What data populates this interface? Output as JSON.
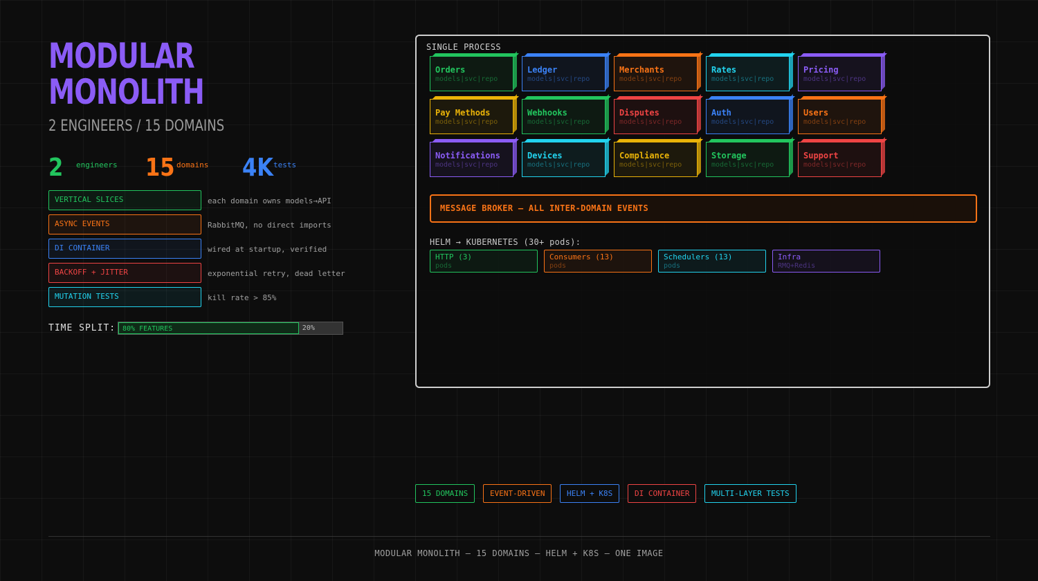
{
  "title": {
    "line1": "MODULAR",
    "line2": "MONOLITH"
  },
  "subtitle": "2 ENGINEERS / 15 DOMAINS",
  "colors": {
    "purple": "#8b5cf6",
    "green": "#22c55e",
    "orange": "#f97316",
    "blue": "#3b82f6",
    "red": "#ef4444",
    "cyan": "#22d3ee",
    "yellow": "#eab308"
  },
  "stats": [
    {
      "value": "2",
      "label": "engineers",
      "color": "#22c55e"
    },
    {
      "value": "15",
      "label": "domains",
      "color": "#f97316"
    },
    {
      "value": "4K",
      "label": "tests",
      "color": "#3b82f6"
    }
  ],
  "features": [
    {
      "label": "VERTICAL SLICES",
      "desc": "each domain owns models→API",
      "color": "#22c55e"
    },
    {
      "label": "ASYNC EVENTS",
      "desc": "RabbitMQ, no direct imports",
      "color": "#f97316"
    },
    {
      "label": "DI CONTAINER",
      "desc": "wired at startup, verified",
      "color": "#3b82f6"
    },
    {
      "label": "BACKOFF + JITTER",
      "desc": "exponential retry, dead letter",
      "color": "#ef4444"
    },
    {
      "label": "MUTATION TESTS",
      "desc": "kill rate > 85%",
      "color": "#22d3ee"
    }
  ],
  "time_split": {
    "label": "TIME SPLIT:",
    "features_label": "80% FEATURES",
    "features_fraction": 0.8,
    "other_label": "20%"
  },
  "process": {
    "label": "SINGLE PROCESS",
    "domains": [
      {
        "name": "Orders",
        "sub": "models|svc|repo",
        "color": "#22c55e"
      },
      {
        "name": "Ledger",
        "sub": "models|svc|repo",
        "color": "#3b82f6"
      },
      {
        "name": "Merchants",
        "sub": "models|svc|repo",
        "color": "#f97316"
      },
      {
        "name": "Rates",
        "sub": "models|svc|repo",
        "color": "#22d3ee"
      },
      {
        "name": "Pricing",
        "sub": "models|svc|repo",
        "color": "#8b5cf6"
      },
      {
        "name": "Pay Methods",
        "sub": "models|svc|repo",
        "color": "#eab308"
      },
      {
        "name": "Webhooks",
        "sub": "models|svc|repo",
        "color": "#22c55e"
      },
      {
        "name": "Disputes",
        "sub": "models|svc|repo",
        "color": "#ef4444"
      },
      {
        "name": "Auth",
        "sub": "models|svc|repo",
        "color": "#3b82f6"
      },
      {
        "name": "Users",
        "sub": "models|svc|repo",
        "color": "#f97316"
      },
      {
        "name": "Notifications",
        "sub": "models|svc|repo",
        "color": "#8b5cf6"
      },
      {
        "name": "Devices",
        "sub": "models|svc|repo",
        "color": "#22d3ee"
      },
      {
        "name": "Compliance",
        "sub": "models|svc|repo",
        "color": "#eab308"
      },
      {
        "name": "Storage",
        "sub": "models|svc|repo",
        "color": "#22c55e"
      },
      {
        "name": "Support",
        "sub": "models|svc|repo",
        "color": "#ef4444"
      }
    ],
    "broker": "MESSAGE BROKER — ALL INTER-DOMAIN EVENTS",
    "helm_label": "HELM → KUBERNETES (30+ pods):",
    "pods": [
      {
        "name": "HTTP (3)",
        "sub": "pods",
        "color": "#22c55e"
      },
      {
        "name": "Consumers (13)",
        "sub": "pods",
        "color": "#f97316"
      },
      {
        "name": "Schedulers (13)",
        "sub": "pods",
        "color": "#22d3ee"
      },
      {
        "name": "Infra",
        "sub": "RMQ+Redis",
        "color": "#8b5cf6"
      }
    ]
  },
  "tags": [
    {
      "label": "15 DOMAINS",
      "color": "#22c55e"
    },
    {
      "label": "EVENT-DRIVEN",
      "color": "#f97316"
    },
    {
      "label": "HELM + K8S",
      "color": "#3b82f6"
    },
    {
      "label": "DI CONTAINER",
      "color": "#ef4444"
    },
    {
      "label": "MULTI-LAYER TESTS",
      "color": "#22d3ee"
    }
  ],
  "footer": "MODULAR MONOLITH — 15 DOMAINS — HELM + K8S — ONE IMAGE"
}
